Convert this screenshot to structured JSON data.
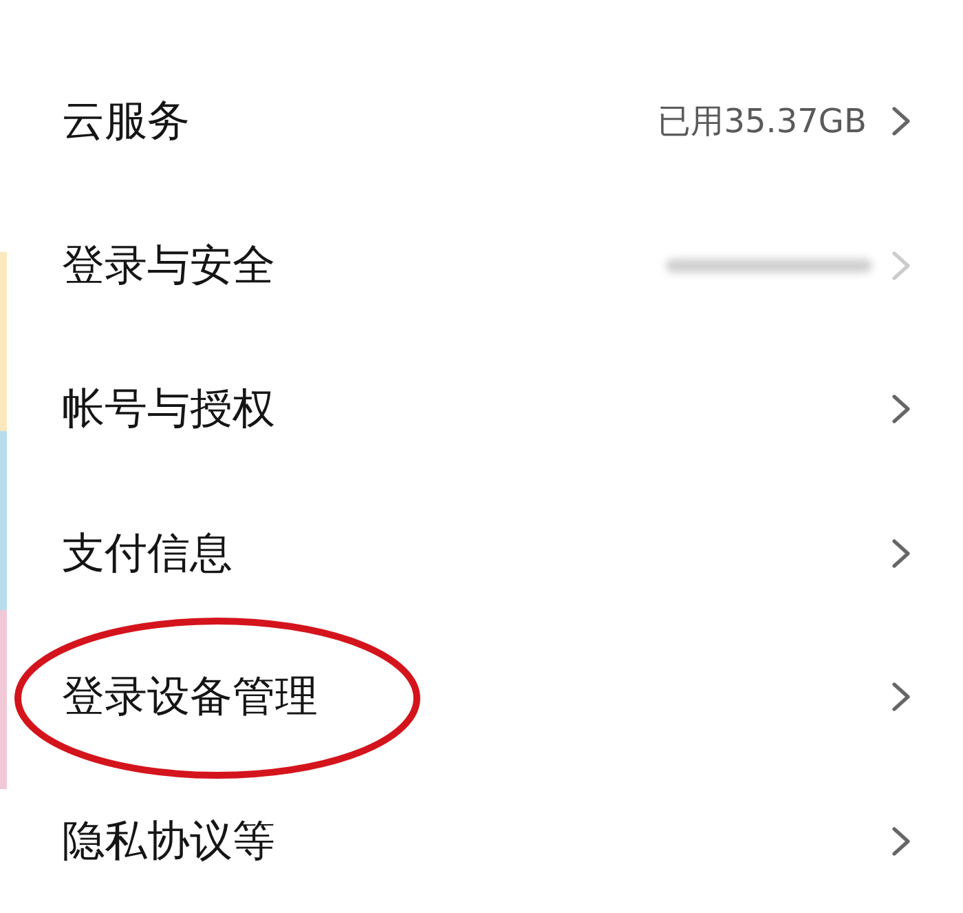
{
  "settings": {
    "items": [
      {
        "label": "云服务",
        "kind": "value",
        "value": "已用35.37GB",
        "highlighted": false
      },
      {
        "label": "登录与安全",
        "kind": "blurred",
        "highlighted": false
      },
      {
        "label": "帐号与授权",
        "kind": "plain",
        "highlighted": false
      },
      {
        "label": "支付信息",
        "kind": "plain",
        "highlighted": false
      },
      {
        "label": "登录设备管理",
        "kind": "plain",
        "highlighted": true
      },
      {
        "label": "隐私协议等",
        "kind": "plain",
        "highlighted": false
      }
    ]
  }
}
